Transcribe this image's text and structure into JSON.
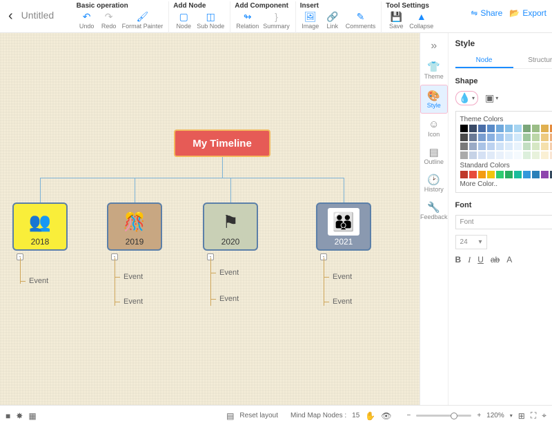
{
  "header": {
    "title": "Untitled",
    "groups": {
      "basic": {
        "title": "Basic operation",
        "undo": "Undo",
        "redo": "Redo",
        "fmt": "Format Painter"
      },
      "add_node": {
        "title": "Add Node",
        "node": "Node",
        "sub": "Sub Node"
      },
      "add_comp": {
        "title": "Add Component",
        "rel": "Relation",
        "sum": "Summary"
      },
      "insert": {
        "title": "Insert",
        "img": "Image",
        "link": "Link",
        "com": "Comments"
      },
      "tools": {
        "title": "Tool Settings",
        "save": "Save",
        "col": "Collapse"
      }
    },
    "share": "Share",
    "export": "Export"
  },
  "canvas": {
    "root": "My Timeline",
    "years": [
      "2018",
      "2019",
      "2020",
      "2021"
    ],
    "event": "Event"
  },
  "sidebar": {
    "title": "Style",
    "tabs": {
      "node": "Node",
      "structure": "Structure"
    },
    "vtabs": {
      "theme": "Theme",
      "style": "Style",
      "icon": "Icon",
      "outline": "Outline",
      "history": "History",
      "feedback": "Feedback"
    },
    "shape": "Shape",
    "theme_colors": "Theme Colors",
    "standard_colors": "Standard Colors",
    "more_color": "More Color..",
    "font_section": "Font",
    "font_label": "Font",
    "font_size": "24",
    "B": "B",
    "I": "I",
    "U": "U",
    "ab": "ab",
    "A": "A"
  },
  "status": {
    "reset": "Reset layout",
    "nodes_label": "Mind Map Nodes :",
    "nodes": "15",
    "zoom": "120%"
  },
  "colors": {
    "theme": [
      [
        "#000000",
        "#3a4a66",
        "#4a6ea8",
        "#5a8bc8",
        "#6fa8dc",
        "#88c0e8",
        "#a7d5f2",
        "#7aa67a",
        "#9bbd87",
        "#e0b050",
        "#e58a3c",
        "#d65a3a"
      ],
      [
        "#4a4a4a",
        "#6a7a96",
        "#7a9ed0",
        "#8ab0e0",
        "#9fc5ef",
        "#b8d8f4",
        "#d0e8fa",
        "#9ec79e",
        "#bcd6a8",
        "#edca80",
        "#efb07a",
        "#e38a74"
      ],
      [
        "#7a7a7a",
        "#9aaac6",
        "#aac3e6",
        "#bcd2f0",
        "#cfe2f7",
        "#dcebfa",
        "#e8f3fc",
        "#c2dec2",
        "#d6e7c4",
        "#f5e0ac",
        "#f6cfad",
        "#efbcae"
      ],
      [
        "#aaaaaa",
        "#c6d2e6",
        "#d5e1f4",
        "#e0eaf8",
        "#e9f1fb",
        "#eff6fd",
        "#f5fafe",
        "#dcefdc",
        "#e8f2dc",
        "#faf0d4",
        "#fae6d4",
        "#f7ddd6"
      ]
    ],
    "standard": [
      "#c0392b",
      "#e74c3c",
      "#f39c12",
      "#f1c40f",
      "#2ecc71",
      "#27ae60",
      "#1abc9c",
      "#3498db",
      "#2980b9",
      "#8e44ad",
      "#34495e",
      "#2c3e50"
    ]
  }
}
